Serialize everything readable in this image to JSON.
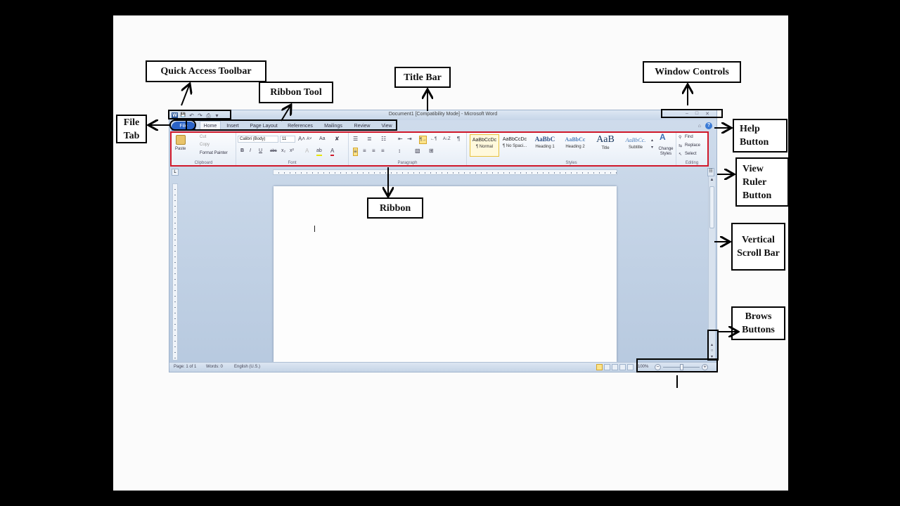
{
  "callouts": {
    "quick_access_toolbar": "Quick Access Toolbar",
    "ribbon_tool": "Ribbon Tool",
    "title_bar": "Title Bar",
    "window_controls": "Window Controls",
    "file_tab": "File Tab",
    "help_button": "Help Button",
    "view_ruler_button": "View Ruler Button",
    "ribbon": "Ribbon",
    "vertical_scroll_bar": "Vertical Scroll Bar",
    "brows_buttons": "Brows Buttons"
  },
  "window": {
    "title": "Document1 [Compatibility Mode] - Microsoft Word",
    "controls": {
      "minimize": "–",
      "restore": "□",
      "close": "✕"
    },
    "qat": {
      "logo": "W",
      "save": "💾",
      "undo": "↶",
      "redo": "↷",
      "print": "⎙",
      "customize": "▾"
    }
  },
  "tabs": [
    "File",
    "Home",
    "Insert",
    "Page Layout",
    "References",
    "Mailings",
    "Review",
    "View"
  ],
  "active_tab": "Home",
  "help_icon": "?",
  "minimize_ribbon_icon": "⌂",
  "ribbon": {
    "clipboard": {
      "label": "Clipboard",
      "paste": "Paste",
      "cut": "Cut",
      "copy": "Copy",
      "format_painter": "Format Painter"
    },
    "font": {
      "label": "Font",
      "font_name": "Calibri (Body)",
      "font_size": "11",
      "grow": "A˄",
      "shrink": "A˅",
      "change_case": "Aa",
      "clear": "✘",
      "bold": "B",
      "italic": "I",
      "underline": "U",
      "strike": "abc",
      "subscript": "x₂",
      "superscript": "x²",
      "effects": "A",
      "highlight": "ab",
      "font_color": "A"
    },
    "paragraph": {
      "label": "Paragraph",
      "bullets": "☰",
      "numbering": "≣",
      "multilevel": "☷",
      "decrease_indent": "⇤",
      "increase_indent": "⇥",
      "ltr": "¶→",
      "rtl": "←¶",
      "sort": "A↓Z",
      "show_marks": "¶",
      "align_left": "≡",
      "center": "≡",
      "align_right": "≡",
      "justify": "≡",
      "line_spacing": "↕",
      "shading": "▧",
      "borders": "⊞"
    },
    "styles": {
      "label": "Styles",
      "items": [
        {
          "sample": "AaBbCcDc",
          "name": "¶ Normal",
          "selected": true
        },
        {
          "sample": "AaBbCcDc",
          "name": "¶ No Spaci...",
          "selected": false
        },
        {
          "sample": "AaBbC",
          "name": "Heading 1",
          "selected": false
        },
        {
          "sample": "AaBbCc",
          "name": "Heading 2",
          "selected": false
        },
        {
          "sample": "AaB",
          "name": "Title",
          "selected": false
        },
        {
          "sample": "AaBbCc.",
          "name": "Subtitle",
          "selected": false
        }
      ],
      "change_styles": "Change Styles"
    },
    "editing": {
      "label": "Editing",
      "find": "Find",
      "replace": "Replace",
      "select": "Select"
    }
  },
  "ruler_toggle": "L",
  "view_ruler_icon": "☷",
  "scroll": {
    "up": "▲",
    "browse_prev": "▴",
    "browse_object": "○",
    "browse_next": "▾"
  },
  "status": {
    "page": "Page: 1 of 1",
    "words": "Words: 0",
    "language": "English (U.S.)",
    "zoom": "100%",
    "zoom_level": 0.5,
    "zoom_minus": "−",
    "zoom_plus": "+"
  }
}
